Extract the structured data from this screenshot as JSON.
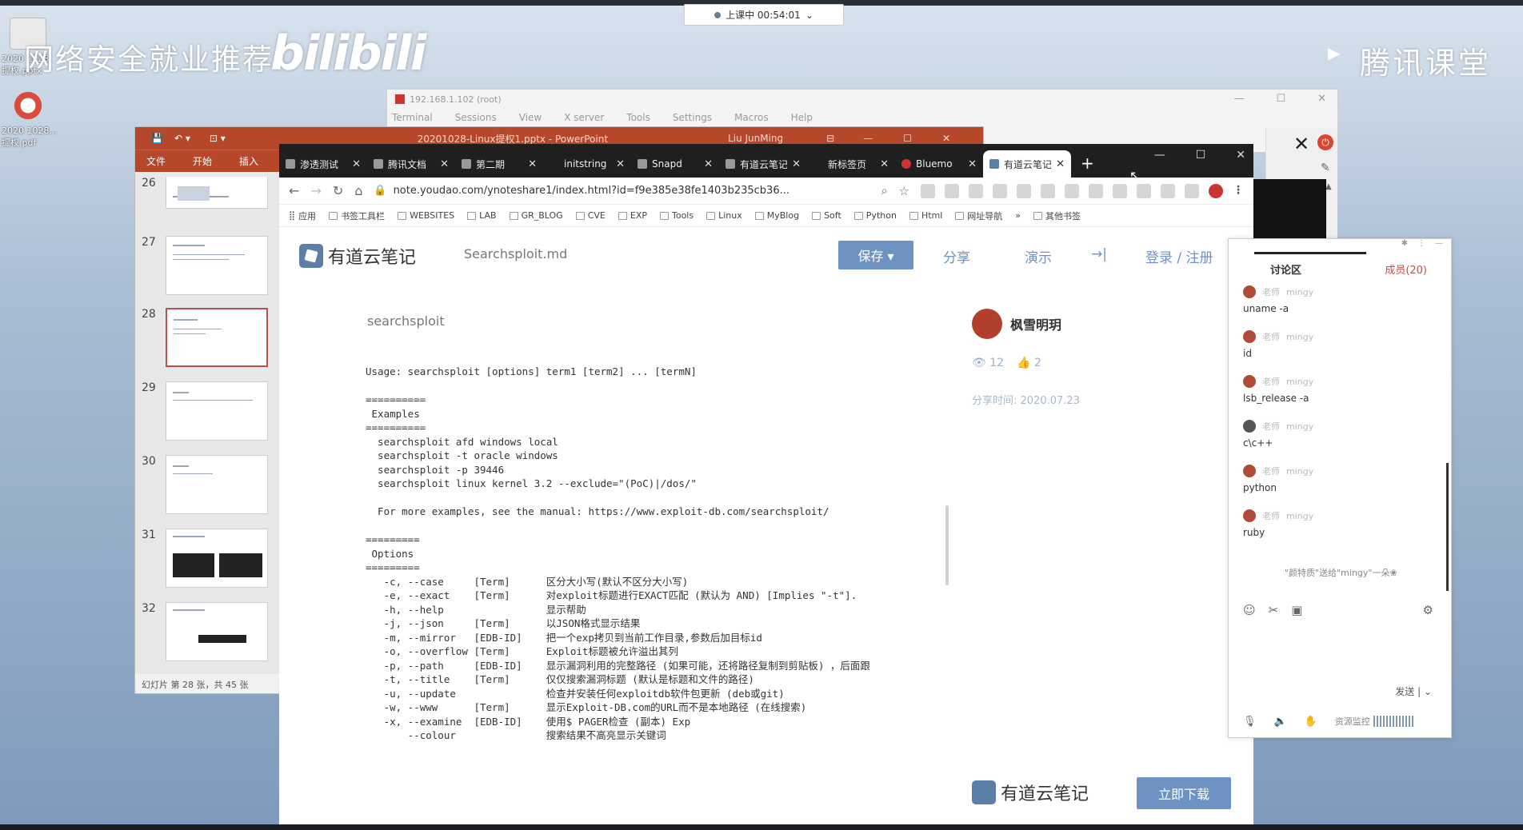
{
  "overlay": {
    "banner": "网络安全就业推荐",
    "bilibili": "bilibili",
    "tencent": "腾讯课堂",
    "class_status": "上课中 00:54:01"
  },
  "desktop_icons": [
    {
      "label": "2020 1028\n提权.pptx"
    },
    {
      "label": "2020 1028...\n提权.pdf"
    }
  ],
  "terminal": {
    "title": "192.168.1.102 (root)",
    "menu": [
      "Terminal",
      "Sessions",
      "View",
      "X server",
      "Tools",
      "Settings",
      "Macros",
      "Help"
    ]
  },
  "powerpoint": {
    "title": "20201028-Linux提权1.pptx - PowerPoint",
    "user": "Liu JunMing",
    "ribbon": [
      "文件",
      "开始",
      "插入"
    ],
    "slides": [
      "26",
      "27",
      "28",
      "29",
      "30",
      "31",
      "32"
    ],
    "active_slide": "28",
    "status": "幻灯片 第 28 张，共 45 张"
  },
  "chrome": {
    "tabs": [
      {
        "label": "渗透测试"
      },
      {
        "label": "腾讯文档"
      },
      {
        "label": "第二期"
      },
      {
        "label": "initstring"
      },
      {
        "label": "Snapd"
      },
      {
        "label": "有道云笔记"
      },
      {
        "label": "新标签页"
      },
      {
        "label": "Bluemo"
      },
      {
        "label": "有道云笔记"
      }
    ],
    "url": "note.youdao.com/ynoteshare1/index.html?id=f9e385e38fe1403b235cb36...",
    "bookmarks": [
      "应用",
      "书签工具栏",
      "WEBSITES",
      "LAB",
      "GR_BLOG",
      "CVE",
      "EXP",
      "Tools",
      "Linux",
      "MyBlog",
      "Soft",
      "Python",
      "Html",
      "网址导航",
      "»",
      "其他书签"
    ]
  },
  "youdao": {
    "logo": "有道云笔记",
    "doc_name": "Searchsploit.md",
    "save": "保存 ▾",
    "share": "分享",
    "present": "演示",
    "login": "登录 / 注册",
    "heading": "searchsploit",
    "content": "Usage: searchsploit [options] term1 [term2] ... [termN]\n\n==========\n Examples\n==========\n  searchsploit afd windows local\n  searchsploit -t oracle windows\n  searchsploit -p 39446\n  searchsploit linux kernel 3.2 --exclude=\"(PoC)|/dos/\"\n\n  For more examples, see the manual: https://www.exploit-db.com/searchsploit/\n\n=========\n Options\n=========\n   -c, --case     [Term]      区分大小写(默认不区分大小写)\n   -e, --exact    [Term]      对exploit标题进行EXACT匹配 (默认为 AND) [Implies \"-t\"].\n   -h, --help                 显示帮助\n   -j, --json     [Term]      以JSON格式显示结果\n   -m, --mirror   [EDB-ID]    把一个exp拷贝到当前工作目录,参数后加目标id\n   -o, --overflow [Term]      Exploit标题被允许溢出其列\n   -p, --path     [EDB-ID]    显示漏洞利用的完整路径 (如果可能，还将路径复制到剪贴板) ，后面跟\n   -t, --title    [Term]      仅仅搜索漏洞标题 (默认是标题和文件的路径)\n   -u, --update               检查并安装任何exploitdb软件包更新 (deb或git)\n   -w, --www      [Term]      显示Exploit-DB.com的URL而不是本地路径 (在线搜索)\n   -x, --examine  [EDB-ID]    使用$ PAGER检查 (副本) Exp\n       --colour               搜索结果不高亮显示关键词",
    "author": "枫雪明玥",
    "views": "12",
    "likes": "2",
    "share_time": "分享时间: 2020.07.23",
    "footer_logo": "有道云笔记",
    "download": "立即下载"
  },
  "discussion": {
    "tab_discussion": "讨论区",
    "tab_members": "成员(20)",
    "messages": [
      {
        "role": "老师",
        "user": "mingy",
        "text": "uname -a"
      },
      {
        "role": "老师",
        "user": "mingy",
        "text": "id"
      },
      {
        "role": "老师",
        "user": "mingy",
        "text": "lsb_release -a"
      },
      {
        "role": "老师",
        "user": "mingy",
        "text": "c\\c++"
      },
      {
        "role": "老师",
        "user": "mingy",
        "text": "python"
      },
      {
        "role": "老师",
        "user": "mingy",
        "text": "ruby"
      }
    ],
    "gift": "\"颜特质\"送给\"mingy\"一朵❀",
    "send": "发送",
    "resource": "资源监控"
  }
}
